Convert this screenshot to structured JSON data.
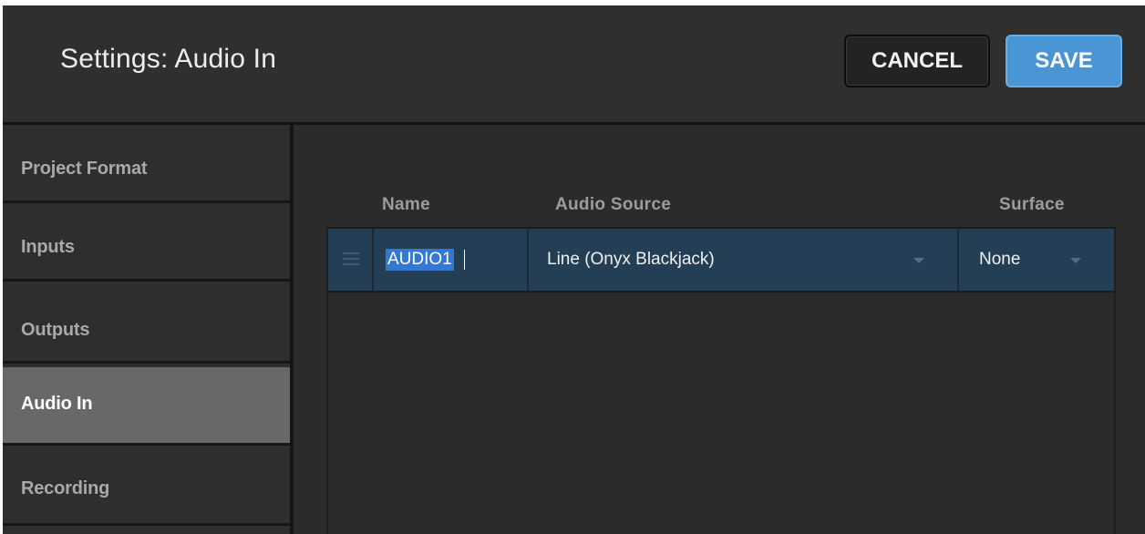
{
  "header": {
    "title": "Settings: Audio In",
    "cancel_label": "CANCEL",
    "save_label": "SAVE"
  },
  "sidebar": {
    "items": [
      {
        "label": "Project Format",
        "active": false
      },
      {
        "label": "Inputs",
        "active": false
      },
      {
        "label": "Outputs",
        "active": false
      },
      {
        "label": "Audio In",
        "active": true
      },
      {
        "label": "Recording",
        "active": false
      }
    ]
  },
  "table": {
    "columns": {
      "name": "Name",
      "source": "Audio Source",
      "surface": "Surface"
    },
    "rows": [
      {
        "name": "AUDIO1",
        "source": "Line (Onyx Blackjack)",
        "surface": "None"
      }
    ]
  },
  "icons": {
    "drag": "drag-handle-icon",
    "dropdown": "chevron-down-icon"
  },
  "colors": {
    "accent": "#4a95d4",
    "selected_row": "#243f55",
    "active_nav": "#686868",
    "text_selection": "#3478d4"
  }
}
